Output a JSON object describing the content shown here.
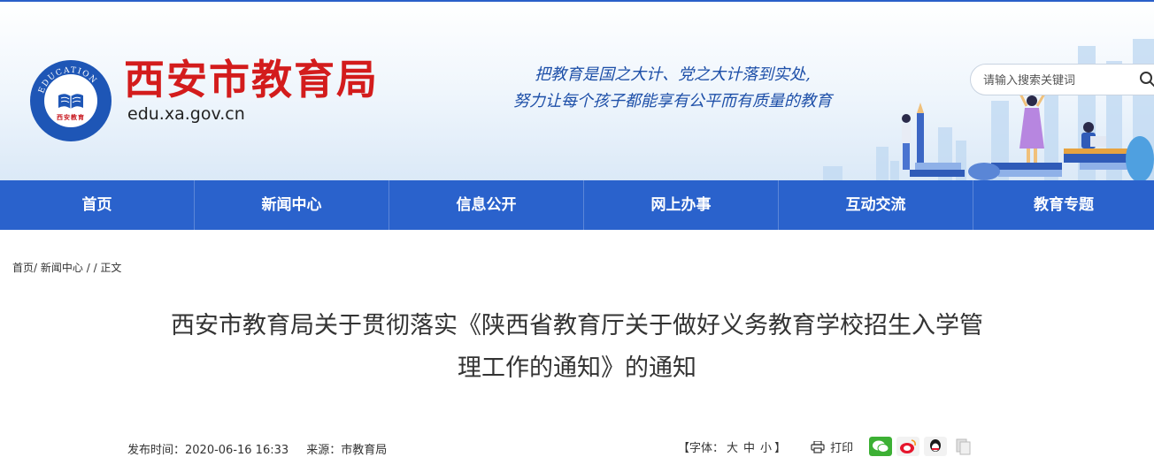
{
  "header": {
    "site_title": "西安市教育局",
    "site_domain": "edu.xa.gov.cn",
    "logo_label": "西安教育",
    "logo_ring_text": "EDUCATION",
    "slogan_line1": "把教育是国之大计、党之大计落到实处,",
    "slogan_line2": "努力让每个孩子都能享有公平而有质量的教育",
    "search_placeholder": "请输入搜索关键词",
    "search_icon": "search-icon"
  },
  "nav": {
    "items": [
      {
        "label": "首页"
      },
      {
        "label": "新闻中心"
      },
      {
        "label": "信息公开"
      },
      {
        "label": "网上办事"
      },
      {
        "label": "互动交流"
      },
      {
        "label": "教育专题"
      }
    ]
  },
  "breadcrumb": {
    "home": "首页",
    "sep1": "/ ",
    "news": "新闻中心",
    "sep2": " / / ",
    "current": "正文"
  },
  "article": {
    "title_line1": "西安市教育局关于贯彻落实《陕西省教育厅关于做好义务教育学校招生入学管",
    "title_line2": "理工作的通知》的通知",
    "publish_time": "发布时间：2020-06-16 16:33",
    "source": "来源：市教育局"
  },
  "tools": {
    "font_prefix": "【字体：",
    "font_large": "大",
    "font_medium": "中",
    "font_small": "小",
    "font_suffix": "】",
    "print_label": "打印"
  },
  "share": [
    {
      "name": "wechat-share-icon",
      "color": "#3cb034"
    },
    {
      "name": "weibo-share-icon",
      "color": "#e6162d"
    },
    {
      "name": "qq-share-icon",
      "color": "#1b8bd8"
    },
    {
      "name": "copy-share-icon",
      "color": "#d8d8d8"
    }
  ],
  "colors": {
    "nav_bg": "#2a62cc",
    "title_red": "#d31c1c",
    "slogan_blue": "#1d4fa8"
  }
}
